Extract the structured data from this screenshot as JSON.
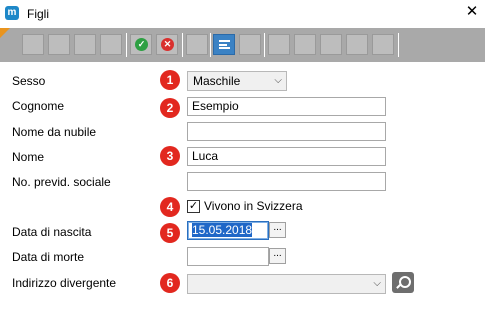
{
  "window": {
    "title": "Figli",
    "app_icon_letter": "m",
    "close_glyph": "✕"
  },
  "toolbar": {
    "buttons": [
      {
        "icon": "blank-icon"
      },
      {
        "icon": "blank-icon"
      },
      {
        "icon": "blank-icon"
      },
      {
        "icon": "blank-icon"
      },
      {
        "icon": "confirm-icon"
      },
      {
        "icon": "cancel-icon"
      },
      {
        "icon": "blank-icon"
      },
      {
        "icon": "list-icon"
      },
      {
        "icon": "blank-icon"
      },
      {
        "icon": "blank-icon"
      },
      {
        "icon": "blank-icon"
      },
      {
        "icon": "blank-icon"
      },
      {
        "icon": "blank-icon"
      },
      {
        "icon": "blank-icon"
      }
    ],
    "colors": {
      "background": "#a9a9a9",
      "confirm": "#2ea043",
      "cancel": "#d9302e",
      "list": "#3b82c4",
      "corner": "#e9941e"
    }
  },
  "form": {
    "sesso": {
      "label": "Sesso",
      "value": "Maschile",
      "badge": "1"
    },
    "cognome": {
      "label": "Cognome",
      "value": "Esempio",
      "badge": "2"
    },
    "nome_nubile": {
      "label": "Nome da nubile",
      "value": ""
    },
    "nome": {
      "label": "Nome",
      "value": "Luca",
      "badge": "3"
    },
    "previd": {
      "label": "No. previd. sociale",
      "value": ""
    },
    "vivono": {
      "label": "Vivono in Svizzera",
      "checked": true,
      "badge": "4"
    },
    "nascita": {
      "label": "Data di nascita",
      "value": "15.05.2018",
      "badge": "5",
      "button": "..."
    },
    "morte": {
      "label": "Data di morte",
      "value": "",
      "button": "..."
    },
    "indirizzo": {
      "label": "Indirizzo divergente",
      "value": "",
      "badge": "6"
    }
  },
  "badge_color": "#e2281f"
}
